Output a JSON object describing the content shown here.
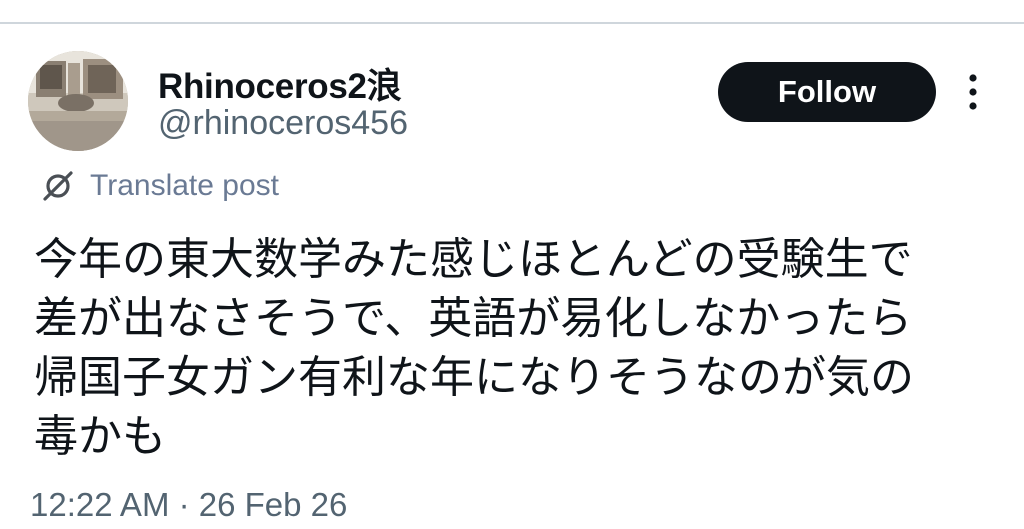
{
  "author": {
    "display_name": "Rhinoceros2浪",
    "handle": "@rhinoceros456"
  },
  "follow_button": {
    "label": "Follow"
  },
  "translate": {
    "label": "Translate post"
  },
  "post": {
    "text": "今年の東大数学みた感じほとんどの受験生で\n差が出なさそうで、英語が易化しなかったら\n帰国子女ガン有利な年になりそうなのが気の\n毒かも",
    "timestamp": "12:22 AM · 26 Feb 26"
  },
  "colors": {
    "follow_bg": "#0f1419",
    "secondary_text": "#536471",
    "translate_text": "#6a7a94",
    "divider": "#cfd6dc"
  },
  "icons": {
    "more": "more-vertical-icon",
    "translate": "translate-globe-icon"
  }
}
